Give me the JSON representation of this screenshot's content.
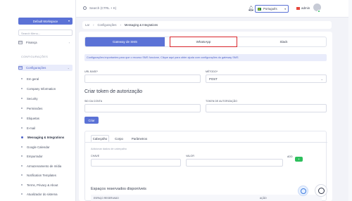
{
  "sidebar": {
    "workspace_button": "Default Workspace",
    "search_placeholder": "Search Menu...",
    "finance_label": "Finança",
    "group_title": "CONFIGURAÇÕES",
    "config_label": "Configurações",
    "sub_items": [
      "Em geral",
      "Company Information",
      "Security",
      "Permissões",
      "Etiquetas",
      "E-mail",
      "Messaging & Integrations",
      "Google Calendar",
      "Empurrador",
      "Armazenamento de mídia",
      "Notification Templates",
      "Terms, Privacy & About",
      "Atualizador do sistema"
    ],
    "active_sub_index": 6
  },
  "topbar": {
    "search_text": "Search (CTRL + K)",
    "language": "Português",
    "user_name": "admin"
  },
  "breadcrumb": {
    "home": "Lar",
    "parent": "Configurações",
    "current": "Messaging & Integrations"
  },
  "tabs": {
    "sms_gateway": "Gateway de SMS",
    "whatsapp": "WhatsApp",
    "slack": "Slack"
  },
  "info_text": "Configurações importantes para que o recurso SMS funcione, Clique aqui para obter ajuda com configurações do gateway SMS",
  "form": {
    "base_url_label": "URL BASE*",
    "method_label": "MÉTODO*",
    "method_value": "POST",
    "token_title": "Criar token de autorização",
    "account_sid_label": "SID DA CONTA",
    "auth_token_label": "TOKEN DE AUTORIZAÇÃO",
    "create_button": "Criar"
  },
  "inner": {
    "tabs": [
      "Cabeçalho",
      "Corpo",
      "Parâmetros"
    ],
    "hint": "Adicionar dados de cabeçalho",
    "key_label": "CHAVE",
    "value_label": "VALOR",
    "add_label": "ADD",
    "add_button": "+",
    "reserved_title": "Espaços reservados disponíveis",
    "col_placeholder": "ESPAÇO RESERVADO",
    "col_action": "AÇÃO"
  }
}
